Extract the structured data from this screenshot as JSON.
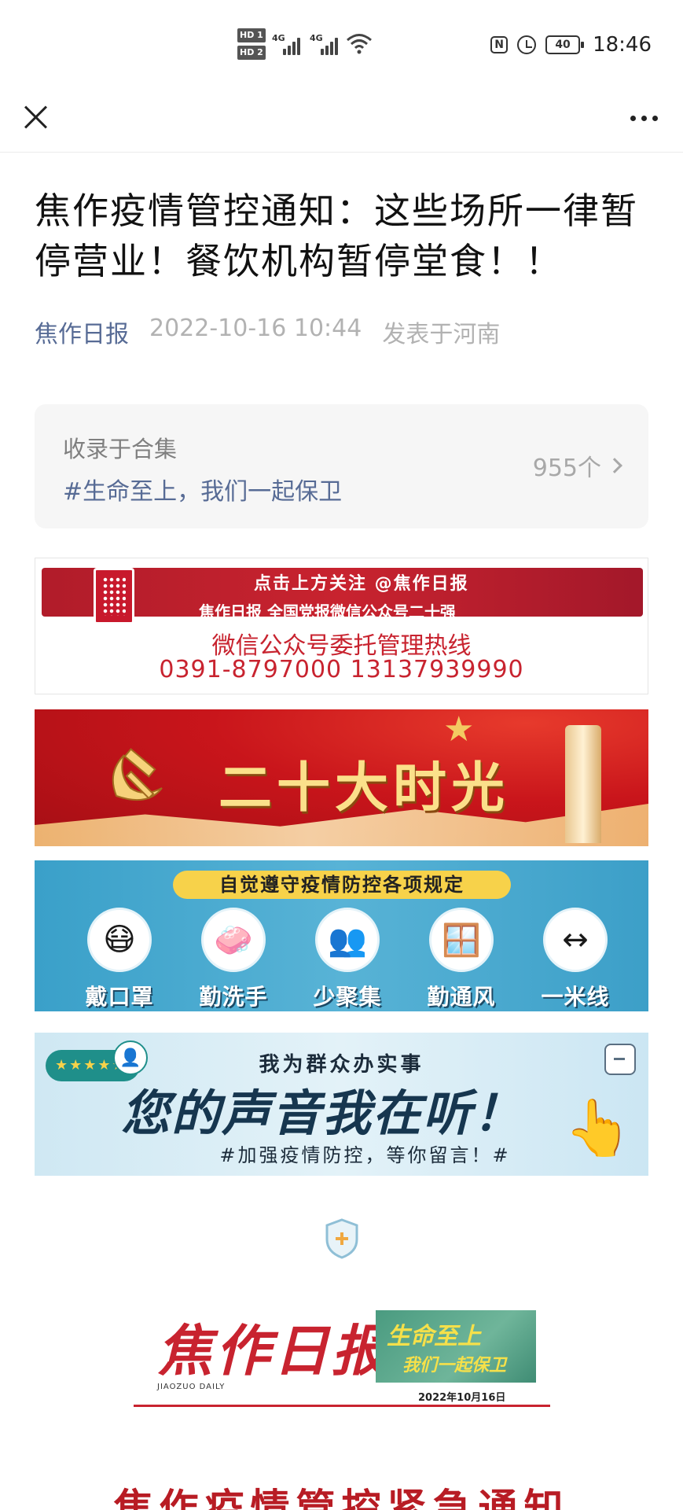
{
  "status_bar": {
    "hd1": "HD 1",
    "hd2": "HD 2",
    "network1": "4G",
    "network2": "4G",
    "nfc": "N",
    "battery": "40",
    "time": "18:46"
  },
  "nav": {
    "close_icon": "close-icon",
    "more_icon": "more-icon"
  },
  "article": {
    "title": "焦作疫情管控通知：这些场所一律暂停营业！餐饮机构暂停堂食！！",
    "source": "焦作日报",
    "datetime": "2022-10-16 10:44",
    "location": "发表于河南"
  },
  "collection": {
    "label": "收录于合集",
    "tag": "#生命至上，我们一起保卫",
    "count": "955个"
  },
  "banners": {
    "hotline": {
      "line1": "点击上方关注 @焦作日报",
      "line2": "焦作日报 全国党报微信公众号二十强",
      "title": "微信公众号委托管理热线",
      "phones": "0391-8797000   13137939990"
    },
    "party": {
      "text": "二十大时光"
    },
    "epidemic": {
      "heading": "自觉遵守疫情防控各项规定",
      "items": [
        "戴口罩",
        "勤洗手",
        "少聚集",
        "勤通风",
        "一米线"
      ]
    },
    "voice": {
      "subtitle": "我为群众办实事",
      "main": "您的声音我在听！",
      "footer": "#加强疫情防控，等你留言！#"
    }
  },
  "masthead": {
    "name": "焦作日报",
    "english": "JIAOZUO DAILY",
    "slogan_line1": "生命至上",
    "slogan_line2": "我们一起保卫",
    "date": "2022年10月16日"
  },
  "content": {
    "urgent_title": "焦作疫情管控紧急通知"
  },
  "colors": {
    "link_blue": "#576b95",
    "meta_gray": "#b2b2b2",
    "party_red": "#c9151b",
    "epidemic_blue": "#3aa0c9"
  }
}
